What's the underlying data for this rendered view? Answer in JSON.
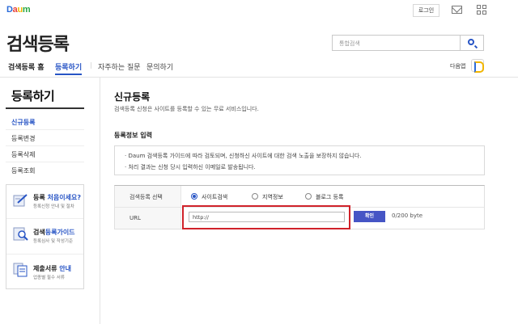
{
  "top": {
    "logo": {
      "d": "D",
      "a": "a",
      "u": "u",
      "m": "m"
    },
    "login_label": "로그인",
    "icons": {
      "mail": "mail-icon",
      "apps": "apps-grid-icon"
    }
  },
  "header": {
    "title": "검색등록",
    "search_placeholder": "통합검색",
    "nav": {
      "home": "검색등록 홈",
      "register": "등록하기",
      "separator": "|",
      "faq": "자주하는 질문",
      "inquiry": "문의하기"
    },
    "daum_app_label": "다음앱"
  },
  "sidebar": {
    "title": "등록하기",
    "items": [
      {
        "label": "신규등록",
        "active": true
      },
      {
        "label": "등록변경",
        "active": false
      },
      {
        "label": "등록삭제",
        "active": false
      },
      {
        "label": "등록조회",
        "active": false
      }
    ],
    "guides": [
      {
        "title_pre": "등록 ",
        "title_hl": "처음이세요?",
        "title_post": "",
        "sub": "등록신청 안내 및 절차",
        "icon": "pencil-doc-icon"
      },
      {
        "title_pre": "검색",
        "title_hl": "등록가이드",
        "title_post": "",
        "sub": "등록심사 및 작성기준",
        "icon": "magnifier-doc-icon"
      },
      {
        "title_pre": "제출서류 ",
        "title_hl": "안내",
        "title_post": "",
        "sub": "업종별 필수 서류",
        "icon": "documents-icon"
      }
    ]
  },
  "main": {
    "title": "신규등록",
    "description": "검색등록 신청은 사이트를 등록할 수 있는 무료 서비스입니다.",
    "section_title": "등록정보 입력",
    "notices": [
      "· Daum 검색등록 가이드에 따라 검토되며, 신청하신 사이트에 대한 검색 노출을 보장하지 않습니다.",
      "· 처리 결과는 신청 당시 입력하신 이메일로 발송됩니다."
    ],
    "form": {
      "type_label": "검색등록 선택",
      "options": [
        {
          "label": "사이트검색",
          "selected": true
        },
        {
          "label": "지역정보",
          "selected": false
        },
        {
          "label": "블로그 등록",
          "selected": false
        }
      ],
      "url_label": "URL",
      "url_value": "http://",
      "confirm_label": "확인",
      "byte_count": "0/200 byte"
    }
  },
  "colors": {
    "accent": "#2754c5",
    "highlight_border": "#d0222a",
    "button": "#4655c5"
  }
}
